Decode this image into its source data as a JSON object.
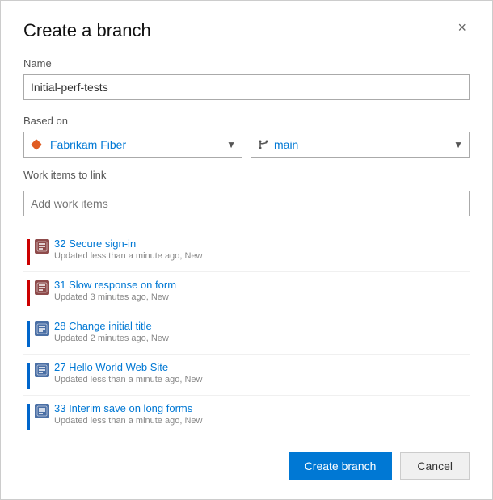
{
  "dialog": {
    "title": "Create a branch",
    "close_label": "×"
  },
  "name_field": {
    "label": "Name",
    "value": "Initial-perf-tests",
    "placeholder": ""
  },
  "based_on": {
    "label": "Based on",
    "repo_options": [
      "Fabrikam Fiber"
    ],
    "repo_selected": "Fabrikam Fiber",
    "branch_options": [
      "main"
    ],
    "branch_selected": "main"
  },
  "work_items": {
    "label": "Work items to link",
    "add_placeholder": "Add work items",
    "items": [
      {
        "id": "32",
        "title": "Secure sign-in",
        "meta": "Updated less than a minute ago, New",
        "color": "#cc0000",
        "icon_bg": "#8e4b4b"
      },
      {
        "id": "31",
        "title": "Slow response on form",
        "meta": "Updated 3 minutes ago, New",
        "color": "#cc0000",
        "icon_bg": "#8e4b4b"
      },
      {
        "id": "28",
        "title": "Change initial title",
        "meta": "Updated 2 minutes ago, New",
        "color": "#0066cc",
        "icon_bg": "#4a6fa5"
      },
      {
        "id": "27",
        "title": "Hello World Web Site",
        "meta": "Updated less than a minute ago, New",
        "color": "#0066cc",
        "icon_bg": "#4a6fa5"
      },
      {
        "id": "33",
        "title": "Interim save on long forms",
        "meta": "Updated less than a minute ago, New",
        "color": "#0066cc",
        "icon_bg": "#4a6fa5"
      }
    ]
  },
  "footer": {
    "create_label": "Create branch",
    "cancel_label": "Cancel"
  }
}
